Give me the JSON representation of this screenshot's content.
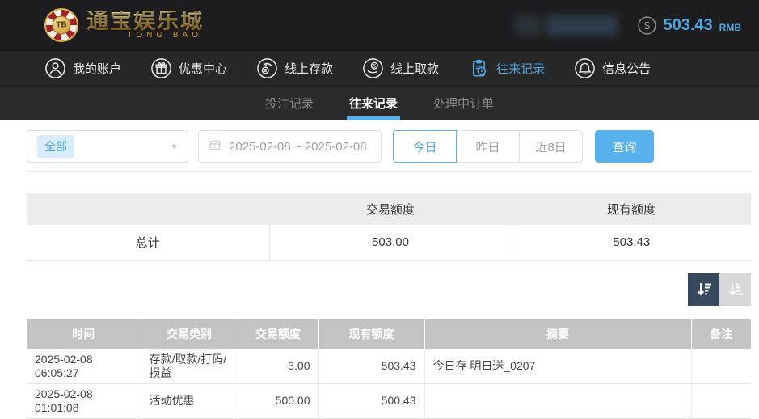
{
  "colors": {
    "accent": "#57b1ec",
    "accent-strong": "#4ea6e0",
    "gold": "#d4a843",
    "sort-dark": "#37495c",
    "sort-light": "#d7d7d7"
  },
  "topbar": {
    "brand_title": "通宝娱乐城",
    "brand_subtitle": "TONG BAO",
    "brand_badge": "TB",
    "balance_symbol": "$",
    "balance_amount": "503.43",
    "balance_unit": "RMB"
  },
  "nav": {
    "items": [
      {
        "label": "我的账户",
        "icon": "user-icon"
      },
      {
        "label": "优惠中心",
        "icon": "gift-icon"
      },
      {
        "label": "线上存款",
        "icon": "deposit-icon"
      },
      {
        "label": "线上取款",
        "icon": "withdraw-icon"
      },
      {
        "label": "往来记录",
        "icon": "records-icon",
        "active": true
      },
      {
        "label": "信息公告",
        "icon": "bell-icon"
      }
    ]
  },
  "subtabs": {
    "items": [
      {
        "label": "投注记录"
      },
      {
        "label": "往来记录",
        "active": true
      },
      {
        "label": "处理中订单"
      }
    ]
  },
  "filters": {
    "type_select": {
      "value": "全部"
    },
    "date_range": {
      "value": "2025-02-08 ~ 2025-02-08"
    },
    "quick_buttons": [
      {
        "label": "今日",
        "active": true
      },
      {
        "label": "昨日"
      },
      {
        "label": "近8日"
      }
    ],
    "search_button": "查询"
  },
  "summary_table": {
    "headers": [
      "",
      "交易额度",
      "现有额度"
    ],
    "row": {
      "label": "总计",
      "transaction_amount": "503.00",
      "current_balance": "503.43"
    }
  },
  "records_table": {
    "headers": [
      "时间",
      "交易类别",
      "交易额度",
      "现有额度",
      "摘要",
      "备注"
    ],
    "rows": [
      {
        "time": "2025-02-08 06:05:27",
        "type": "存款/取款/打码/损益",
        "amount": "3.00",
        "balance": "503.43",
        "summary": "今日存 明日送_0207",
        "note": ""
      },
      {
        "time": "2025-02-08 01:01:08",
        "type": "活动优惠",
        "amount": "500.00",
        "balance": "500.43",
        "summary": "",
        "note": ""
      }
    ]
  }
}
